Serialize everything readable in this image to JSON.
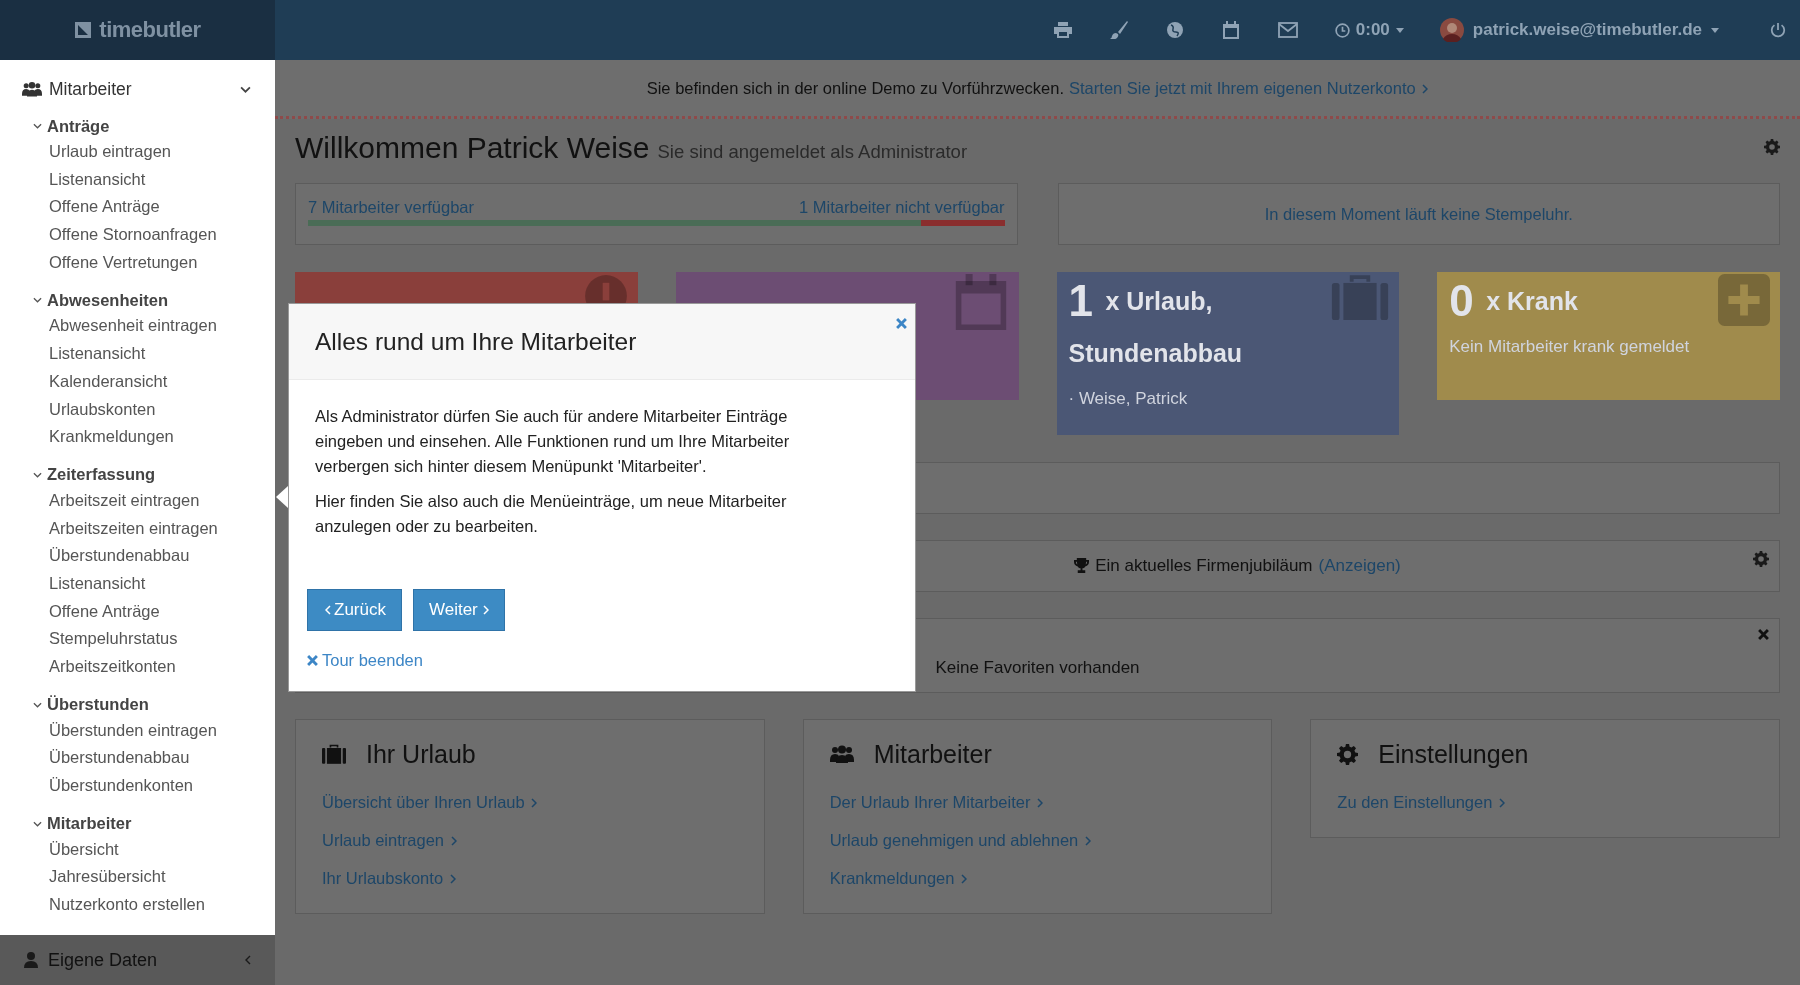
{
  "topbar": {
    "logo": "timebutler",
    "time": "0:00",
    "user": "patrick.weise@timebutler.de"
  },
  "sidebar": {
    "header": {
      "label": "Mitarbeiter",
      "expanded": true
    },
    "sections": [
      {
        "title": "Anträge",
        "expanded": true,
        "items": [
          "Urlaub eintragen",
          "Listenansicht",
          "Offene Anträge",
          "Offene Stornoanfragen",
          "Offene Vertretungen"
        ]
      },
      {
        "title": "Abwesenheiten",
        "expanded": true,
        "items": [
          "Abwesenheit eintragen",
          "Listenansicht",
          "Kalenderansicht",
          "Urlaubskonten",
          "Krankmeldungen"
        ]
      },
      {
        "title": "Zeiterfassung",
        "expanded": true,
        "items": [
          "Arbeitszeit eintragen",
          "Arbeitszeiten eintragen",
          "Überstundenabbau",
          "Listenansicht",
          "Offene Anträge",
          "Stempeluhrstatus",
          "Arbeitszeitkonten"
        ]
      },
      {
        "title": "Überstunden",
        "expanded": true,
        "items": [
          "Überstunden eintragen",
          "Überstundenabbau",
          "Überstundenkonten"
        ]
      },
      {
        "title": "Mitarbeiter",
        "expanded": true,
        "items": [
          "Übersicht",
          "Jahresübersicht",
          "Nutzerkonto erstellen"
        ]
      }
    ],
    "footer": {
      "label": "Eigene Daten",
      "expanded": false
    }
  },
  "banner": {
    "text": "Sie befinden sich in der online Demo zu Vorführzwecken.",
    "link": "Starten Sie jetzt mit Ihrem eigenen Nutzerkonto"
  },
  "welcome": {
    "title": "Willkommen Patrick Weise",
    "subtitle": "Sie sind angemeldet als Administrator"
  },
  "availability": {
    "available": "7 Mitarbeiter verfügbar",
    "unavailable": "1 Mitarbeiter nicht verfügbar",
    "level": 0.88
  },
  "clock_status": "In diesem Moment läuft keine Stempeluhr.",
  "cards": [
    {
      "color": "#8a3f3b"
    },
    {
      "color": "#6c4d73"
    },
    {
      "count": "1",
      "title": "x Urlaub,",
      "subtitle": "Stundenabbau",
      "detail": "· Weise, Patrick",
      "color": "#4b5775"
    },
    {
      "count": "0",
      "title": "x Krank",
      "detail": "Kein Mitarbeiter krank gemeldet",
      "color": "#a08b4c"
    }
  ],
  "jubilee": {
    "text": "Ein aktuelles Firmenjubiläum",
    "link": "(Anzeigen)"
  },
  "favorites": {
    "text": "Keine Favoriten vorhanden"
  },
  "panels": [
    {
      "title": "Ihr Urlaub",
      "links": [
        "Übersicht über Ihren Urlaub",
        "Urlaub eintragen",
        "Ihr Urlaubskonto"
      ]
    },
    {
      "title": "Mitarbeiter",
      "links": [
        "Der Urlaub Ihrer Mitarbeiter",
        "Urlaub genehmigen und ablehnen",
        "Krankmeldungen"
      ]
    },
    {
      "title": "Einstellungen",
      "links": [
        "Zu den Einstellungen"
      ]
    }
  ],
  "modal": {
    "title": "Alles rund um Ihre Mitarbeiter",
    "paragraphs": [
      "Als Administrator dürfen Sie auch für andere Mitarbeiter Einträge eingeben und einsehen. Alle Funktionen rund um Ihre Mitarbeiter verbergen sich hinter diesem Menüpunkt 'Mitarbeiter'.",
      "Hier finden Sie also auch die Menüeinträge, um neue Mitarbeiter anzulegen oder zu bearbeiten."
    ],
    "back": "Zurück",
    "next": "Weiter",
    "end": "Tour beenden"
  }
}
